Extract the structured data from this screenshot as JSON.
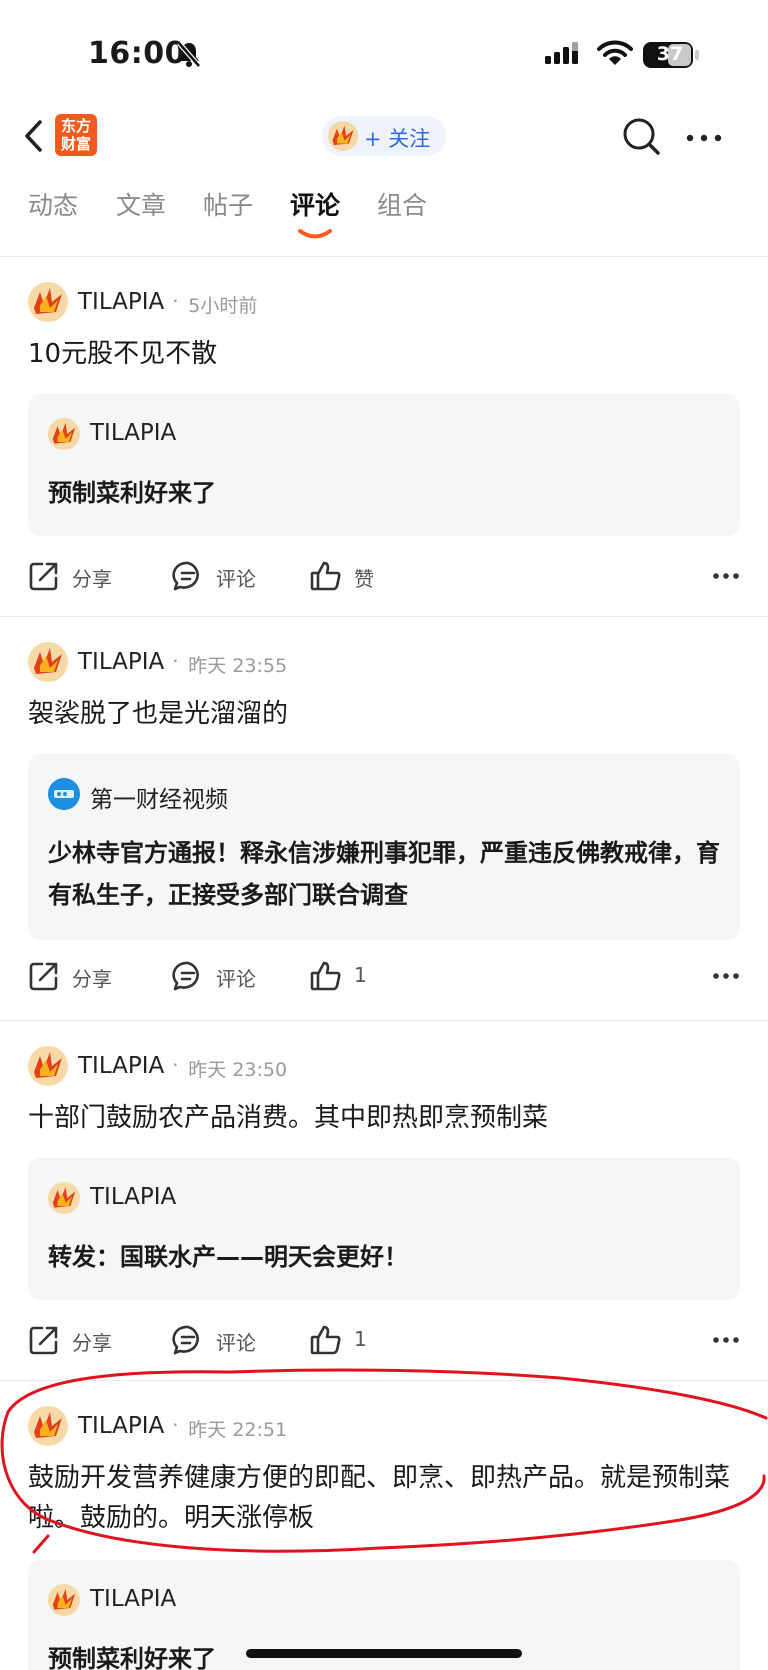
{
  "status_bar": {
    "time": "16:00",
    "battery": "37"
  },
  "nav": {
    "logo_line1": "东方",
    "logo_line2": "财富",
    "follow_label": "+ 关注"
  },
  "tabs": [
    {
      "label": "动态"
    },
    {
      "label": "文章"
    },
    {
      "label": "帖子"
    },
    {
      "label": "评论"
    },
    {
      "label": "组合"
    }
  ],
  "colors": {
    "accent_blue": "#2f6ae0",
    "logo_orange": "#f05a1c",
    "tab_indicator": "#ff5a1f",
    "annotation_red": "#e0141e"
  },
  "posts": [
    {
      "author": "TILAPIA",
      "time": "5小时前",
      "text": "10元股不见不散",
      "quote_author": "TILAPIA",
      "quote_text": "预制菜利好来了",
      "actions": {
        "share": "分享",
        "comment": "评论",
        "like": "赞"
      }
    },
    {
      "author": "TILAPIA",
      "time": "昨天 23:55",
      "text": "袈裟脱了也是光溜溜的",
      "quote_author": "第一财经视频",
      "quote_text": "少林寺官方通报！释永信涉嫌刑事犯罪，严重违反佛教戒律，育有私生子，正接受多部门联合调查",
      "actions": {
        "share": "分享",
        "comment": "评论",
        "like": "1"
      }
    },
    {
      "author": "TILAPIA",
      "time": "昨天 23:50",
      "text": "十部门鼓励农产品消费。其中即热即烹预制菜",
      "quote_author": "TILAPIA",
      "quote_text": "转发：国联水产——明天会更好！",
      "actions": {
        "share": "分享",
        "comment": "评论",
        "like": "1"
      }
    },
    {
      "author": "TILAPIA",
      "time": "昨天 22:51",
      "text": "鼓励开发营养健康方便的即配、即烹、即热产品。就是预制菜啦。鼓励的。明天涨停板",
      "quote_author": "TILAPIA",
      "quote_text": "预制菜利好来了"
    }
  ]
}
